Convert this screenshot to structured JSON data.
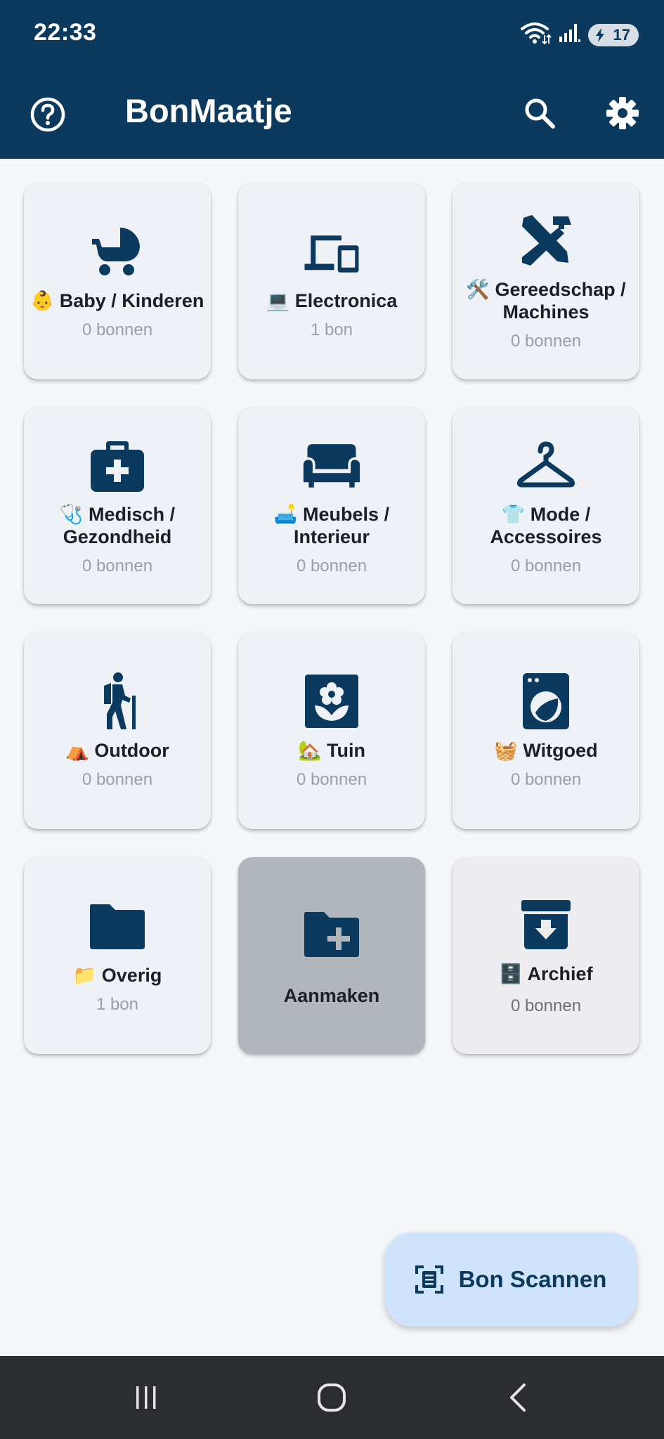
{
  "status_bar": {
    "time": "22:33",
    "battery_level": "17",
    "icons": [
      "wifi-icon",
      "signal-icon",
      "battery-charging-icon"
    ]
  },
  "app_bar": {
    "title": "BonMaatje",
    "help_icon": "help-circle-icon",
    "search_icon": "search-icon",
    "settings_icon": "gear-icon"
  },
  "categories": [
    {
      "icon": "stroller-icon",
      "label": "👶 Baby / Kinderen",
      "count": "0 bonnen"
    },
    {
      "icon": "devices-icon",
      "label": "💻 Electronica",
      "count": "1 bon"
    },
    {
      "icon": "tools-icon",
      "label": "🛠️ Gereedschap / Machines",
      "count": "0 bonnen"
    },
    {
      "icon": "medical-bag-icon",
      "label": "🩺 Medisch / Gezondheid",
      "count": "0 bonnen"
    },
    {
      "icon": "sofa-icon",
      "label": "🛋️ Meubels / Interieur",
      "count": "0 bonnen"
    },
    {
      "icon": "hanger-icon",
      "label": "👕 Mode / Accessoires",
      "count": "0 bonnen"
    },
    {
      "icon": "hiker-icon",
      "label": "⛺ Outdoor",
      "count": "0 bonnen"
    },
    {
      "icon": "flower-icon",
      "label": "🏡 Tuin",
      "count": "0 bonnen"
    },
    {
      "icon": "washing-machine-icon",
      "label": "🧺 Witgoed",
      "count": "0 bonnen"
    },
    {
      "icon": "folder-icon",
      "label": "📁 Overig",
      "count": "1 bon"
    }
  ],
  "create_tile": {
    "icon": "folder-plus-icon",
    "label": "Aanmaken"
  },
  "archive_tile": {
    "icon": "archive-icon",
    "label": "🗄️ Archief",
    "count": "0 bonnen"
  },
  "fab": {
    "icon": "scan-document-icon",
    "label": "Bon Scannen"
  },
  "nav_bar": {
    "icons": [
      "recent-apps-icon",
      "home-icon",
      "back-icon"
    ]
  },
  "colors": {
    "primary": "#0b3a5e",
    "background": "#f5f7fb",
    "tile": "#eef1f6",
    "create_tile": "#b1b6bd",
    "fab": "#cfe3fa",
    "nav_bar": "#2c2d30"
  }
}
